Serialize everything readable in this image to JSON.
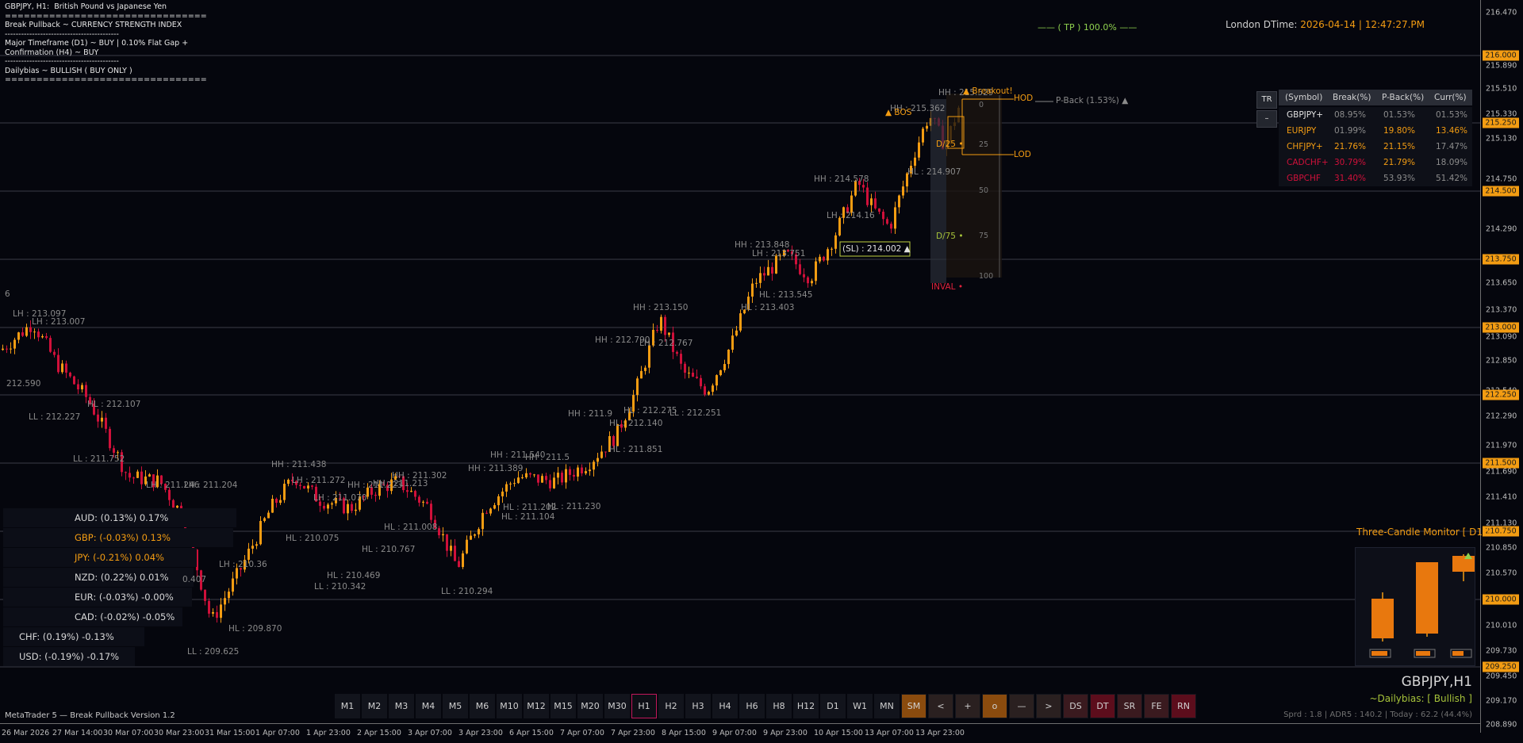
{
  "info_lines": [
    "GBPJPY, H1:  British Pound vs Japanese Yen",
    "================================",
    "Break Pullback ~ CURRENCY STRENGTH INDEX",
    "------------------------------------------",
    "Major Timeframe (D1) ~ BUY | 0.10% Flat Gap +",
    "Confirmation (H4) ~ BUY",
    "------------------------------------------",
    "Dailybias ~ BULLISH ( BUY ONLY )",
    "================================"
  ],
  "clock": {
    "label": "London DTime:",
    "value": "2026-04-14 | 12:47:27.PM"
  },
  "tp_label": "—— ( TP ) 100.0% ——",
  "colors": {
    "background": "#05060d",
    "accent": "#f39c12",
    "bull": "#f39c12",
    "bear": "#d0103a",
    "green": "#8fd14f",
    "inval": "#e0223c"
  },
  "price_axis": {
    "labels": [
      "216.470",
      "215.890",
      "215.510",
      "215.330",
      "215.130",
      "214.750",
      "214.290",
      "213.930",
      "213.650",
      "213.370",
      "213.090",
      "212.850",
      "212.540",
      "212.290",
      "211.970",
      "211.690",
      "211.410",
      "211.130",
      "210.850",
      "210.570",
      "210.290",
      "210.010",
      "209.730",
      "209.450",
      "209.170",
      "208.890"
    ],
    "tags": [
      "216.000",
      "215.250",
      "214.500",
      "213.750",
      "213.000",
      "212.250",
      "211.500",
      "210.750",
      "210.000",
      "209.250"
    ]
  },
  "time_axis": [
    "26 Mar 2026",
    "27 Mar 14:00",
    "30 Mar 07:00",
    "30 Mar 23:00",
    "31 Mar 15:00",
    "1 Apr 07:00",
    "1 Apr 23:00",
    "2 Apr 15:00",
    "3 Apr 07:00",
    "3 Apr 23:00",
    "6 Apr 15:00",
    "7 Apr 07:00",
    "7 Apr 23:00",
    "8 Apr 15:00",
    "9 Apr 07:00",
    "9 Apr 23:00",
    "10 Apr 15:00",
    "13 Apr 07:00",
    "13 Apr 23:00"
  ],
  "annotations": [
    "LH : 213.097",
    "LH : 213.007",
    "212.590",
    "LL : 212.227",
    "HL : 212.107",
    "LL : 211.752",
    "LH : 211.246",
    "LH : 211.204",
    "HH : 211.438",
    "LH : 211.272",
    "LH : 211.070",
    "HH : 211.223",
    "HH : 211.213",
    "HH : 211.302",
    "HL : 210.075",
    "HL : 210.767",
    "HL : 211.008",
    "HL : 210.469",
    "LL : 210.342",
    "LH : 210.36",
    "HL : 209.870",
    "LL : 209.625",
    "LL : 210.294",
    "HH : 211.389",
    "HH : 211.540",
    "HH : 211.5",
    "HL : 211.202",
    "HL : 211.230",
    "HL : 211.104",
    "HH : 211.9",
    "HL : 211.851",
    "HH : 213.150",
    "HH : 212.790",
    "LH : 212.767",
    "HL : 212.275",
    "HL : 212.140",
    "LL : 212.251",
    "HH : 213.848",
    "LH : 213.751",
    "HL : 213.545",
    "HL : 213.403",
    "HH : 214.578",
    "LH : 214.16",
    "HH : 215.362",
    "HH : 215.529",
    "HL : 214.907",
    "0.407",
    "6"
  ],
  "markers": {
    "bos": "▲ BOS",
    "breakout": "▲ Breakout!",
    "hod": "HOD",
    "lod": "LOD",
    "pback": "P-Back (1.53%) ▲",
    "sl": "(SL) : 214.002 ▲",
    "d25": "D/25 •",
    "d75": "D/75 •",
    "inval": "INVAL •",
    "scale": [
      "0",
      "25",
      "50",
      "75",
      "100"
    ]
  },
  "currency_strength": [
    {
      "label": "AUD: (0.13%)  0.17%",
      "color": "#d8d8d8"
    },
    {
      "label": "GBP: (-0.03%)  0.13%",
      "color": "#f39c12"
    },
    {
      "label": "JPY: (-0.21%)  0.04%",
      "color": "#f39c12"
    },
    {
      "label": "NZD: (0.22%)  0.01%",
      "color": "#d8d8d8"
    },
    {
      "label": "EUR: (-0.03%)  -0.00%",
      "color": "#d8d8d8"
    },
    {
      "label": "CAD: (-0.02%)  -0.05%",
      "color": "#d8d8d8"
    },
    {
      "label": "CHF: (0.19%)  -0.13%",
      "color": "#d8d8d8"
    },
    {
      "label": "USD: (-0.19%)  -0.17%",
      "color": "#d8d8d8"
    }
  ],
  "symbol_table": {
    "buttons": {
      "tr": "TR",
      "min": "–"
    },
    "headers": [
      "(Symbol)",
      "Break(%)",
      "P-Back(%)",
      "Curr(%)"
    ],
    "rows": [
      {
        "symbol": "GBPJPY+",
        "break": "08.95%",
        "pback": "01.53%",
        "curr": "01.53%",
        "sc": "#e0e0e0",
        "bc": "#8c8c8c",
        "pc": "#8c8c8c",
        "cc": "#8c8c8c"
      },
      {
        "symbol": "EURJPY",
        "break": "01.99%",
        "pback": "19.80%",
        "curr": "13.46%",
        "sc": "#f39c12",
        "bc": "#8c8c8c",
        "pc": "#f39c12",
        "cc": "#f39c12"
      },
      {
        "symbol": "CHFJPY+",
        "break": "21.76%",
        "pback": "21.15%",
        "curr": "17.47%",
        "sc": "#f39c12",
        "bc": "#f39c12",
        "pc": "#f39c12",
        "cc": "#8c8c8c"
      },
      {
        "symbol": "CADCHF+",
        "break": "30.79%",
        "pback": "21.79%",
        "curr": "18.09%",
        "sc": "#d0103a",
        "bc": "#d0103a",
        "pc": "#f39c12",
        "cc": "#8c8c8c"
      },
      {
        "symbol": "GBPCHF",
        "break": "31.40%",
        "pback": "53.93%",
        "curr": "51.42%",
        "sc": "#d0103a",
        "bc": "#d0103a",
        "pc": "#8c8c8c",
        "cc": "#8c8c8c"
      }
    ]
  },
  "three_candle": {
    "title": "Three-Candle Monitor [ D1 ]"
  },
  "symbol_label": "GBPJPY,H1",
  "bias_label": "~Dailybias: [ Bullish ]",
  "stats_label": "Sprd : 1.8 | ADR5 : 140.2 | Today : 62.2 (44.4%)",
  "footer": "MetaTrader 5 — Break Pullback Version 1.2",
  "timeframes": [
    {
      "label": "M1",
      "style": ""
    },
    {
      "label": "M2",
      "style": ""
    },
    {
      "label": "M3",
      "style": ""
    },
    {
      "label": "M4",
      "style": ""
    },
    {
      "label": "M5",
      "style": ""
    },
    {
      "label": "M6",
      "style": ""
    },
    {
      "label": "M10",
      "style": ""
    },
    {
      "label": "M12",
      "style": ""
    },
    {
      "label": "M15",
      "style": ""
    },
    {
      "label": "M20",
      "style": ""
    },
    {
      "label": "M30",
      "style": ""
    },
    {
      "label": "H1",
      "style": "active"
    },
    {
      "label": "H2",
      "style": ""
    },
    {
      "label": "H3",
      "style": ""
    },
    {
      "label": "H4",
      "style": ""
    },
    {
      "label": "H6",
      "style": ""
    },
    {
      "label": "H8",
      "style": ""
    },
    {
      "label": "H12",
      "style": ""
    },
    {
      "label": "D1",
      "style": ""
    },
    {
      "label": "W1",
      "style": ""
    },
    {
      "label": "MN",
      "style": ""
    },
    {
      "label": "SM",
      "style": "orange"
    },
    {
      "label": "<",
      "style": "gray"
    },
    {
      "label": "+",
      "style": "gray"
    },
    {
      "label": "o",
      "style": "orange"
    },
    {
      "label": "—",
      "style": "gray"
    },
    {
      "label": ">",
      "style": "gray"
    },
    {
      "label": "DS",
      "style": "dark"
    },
    {
      "label": "DT",
      "style": "red"
    },
    {
      "label": "SR",
      "style": "dark"
    },
    {
      "label": "FE",
      "style": "dark"
    },
    {
      "label": "RN",
      "style": "red"
    }
  ]
}
